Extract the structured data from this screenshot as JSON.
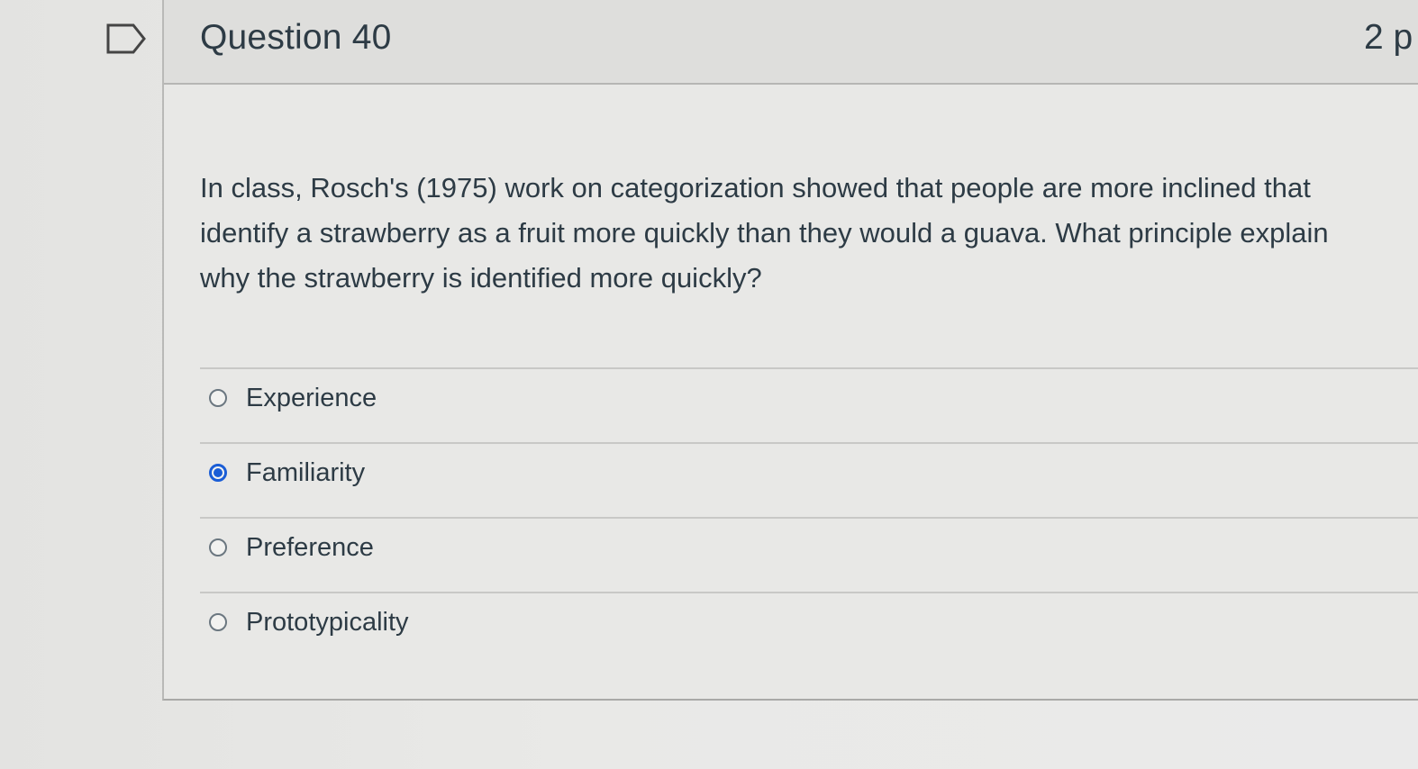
{
  "question": {
    "title": "Question 40",
    "points": "2 p",
    "text_lines": [
      "In class, Rosch's (1975) work on categorization showed that people are more inclined that",
      "identify a strawberry as a fruit more quickly than they would a guava. What principle explain",
      "why the strawberry is identified more quickly?"
    ],
    "answers": [
      {
        "label": "Experience",
        "selected": false
      },
      {
        "label": "Familiarity",
        "selected": true
      },
      {
        "label": "Preference",
        "selected": false
      },
      {
        "label": "Prototypicality",
        "selected": false
      }
    ]
  },
  "icons": {
    "flag": "flag-bookmark-icon"
  },
  "colors": {
    "selected_radio": "#1a5dd6",
    "text": "#2d3b45"
  }
}
